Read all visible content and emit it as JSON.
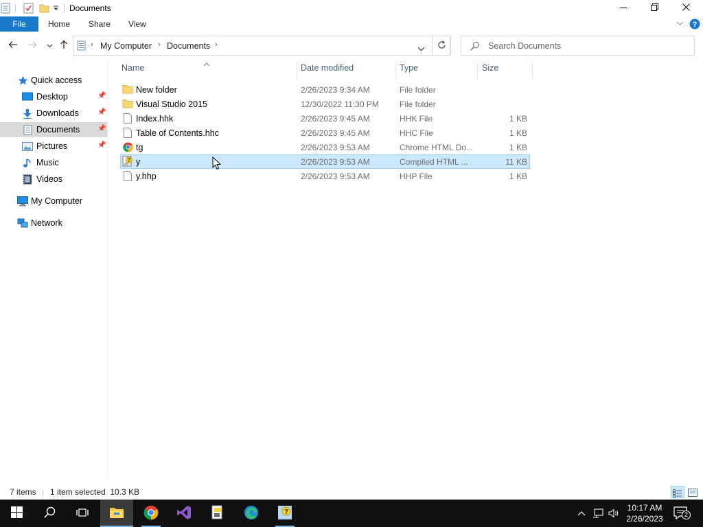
{
  "window": {
    "title": "Documents",
    "minimize_icon": "minimize-icon",
    "restore_icon": "restore-icon",
    "close_icon": "close-icon"
  },
  "ribbon": {
    "file": "File",
    "home": "Home",
    "share": "Share",
    "view": "View"
  },
  "address": {
    "crumbs": [
      "My Computer",
      "Documents"
    ],
    "separator": "›"
  },
  "search": {
    "placeholder": "Search Documents"
  },
  "sidebar": {
    "items": [
      {
        "label": "Quick access",
        "icon": "star-icon",
        "pinned": false
      },
      {
        "label": "Desktop",
        "icon": "desktop-icon",
        "pinned": true
      },
      {
        "label": "Downloads",
        "icon": "download-icon",
        "pinned": true
      },
      {
        "label": "Documents",
        "icon": "documents-icon",
        "pinned": true,
        "selected": true
      },
      {
        "label": "Pictures",
        "icon": "pictures-icon",
        "pinned": true
      },
      {
        "label": "Music",
        "icon": "music-icon",
        "pinned": false
      },
      {
        "label": "Videos",
        "icon": "videos-icon",
        "pinned": false
      },
      {
        "label": "My Computer",
        "icon": "computer-icon",
        "pinned": false
      },
      {
        "label": "Network",
        "icon": "network-icon",
        "pinned": false
      }
    ]
  },
  "columns": {
    "name": "Name",
    "date": "Date modified",
    "type": "Type",
    "size": "Size"
  },
  "files": [
    {
      "name": "New folder",
      "date": "2/26/2023 9:34 AM",
      "type": "File folder",
      "size": "",
      "icon": "folder-icon"
    },
    {
      "name": "Visual Studio 2015",
      "date": "12/30/2022 11:30 PM",
      "type": "File folder",
      "size": "",
      "icon": "folder-icon"
    },
    {
      "name": "Index.hhk",
      "date": "2/26/2023 9:45 AM",
      "type": "HHK File",
      "size": "1 KB",
      "icon": "file-icon"
    },
    {
      "name": "Table of Contents.hhc",
      "date": "2/26/2023 9:45 AM",
      "type": "HHC File",
      "size": "1 KB",
      "icon": "file-icon"
    },
    {
      "name": "tg",
      "date": "2/26/2023 9:53 AM",
      "type": "Chrome HTML Do...",
      "size": "1 KB",
      "icon": "chrome-icon"
    },
    {
      "name": "y",
      "date": "2/26/2023 9:53 AM",
      "type": "Compiled HTML ...",
      "size": "11 KB",
      "icon": "chm-icon",
      "selected": true
    },
    {
      "name": "y.hhp",
      "date": "2/26/2023 9:53 AM",
      "type": "HHP File",
      "size": "1 KB",
      "icon": "file-icon"
    }
  ],
  "status": {
    "count": "7 items",
    "selection": "1 item selected  10.3 KB"
  },
  "taskbar": {
    "time": "10:17 AM",
    "date": "2/26/2023",
    "notifications": "2"
  },
  "colors": {
    "accent": "#1979ca",
    "selection_bg": "#cce8ff",
    "selection_border": "#99d1ff",
    "folder": "#f8d775",
    "taskbar": "#101010"
  }
}
